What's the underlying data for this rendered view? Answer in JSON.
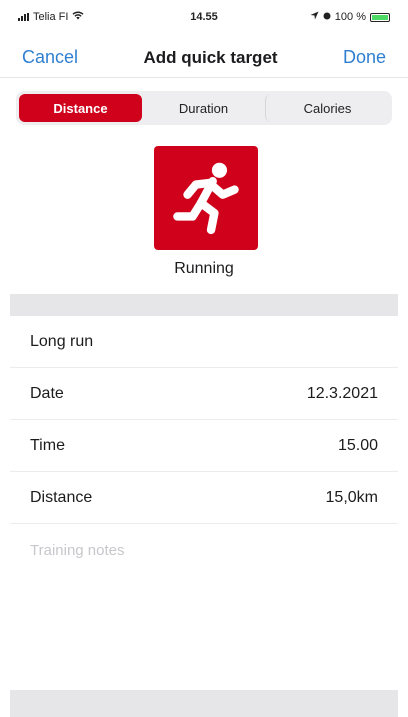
{
  "status_bar": {
    "carrier": "Telia FI",
    "time": "14.55",
    "battery": "100 %"
  },
  "nav": {
    "cancel": "Cancel",
    "title": "Add quick target",
    "done": "Done"
  },
  "segments": [
    {
      "label": "Distance",
      "active": true
    },
    {
      "label": "Duration",
      "active": false
    },
    {
      "label": "Calories",
      "active": false
    }
  ],
  "activity": {
    "icon": "running-person-icon",
    "label": "Running",
    "color": "#d0021b"
  },
  "form": {
    "name": "Long run",
    "date_label": "Date",
    "date_value": "12.3.2021",
    "time_label": "Time",
    "time_value": "15.00",
    "distance_label": "Distance",
    "distance_value": "15,0km",
    "notes_placeholder": "Training notes"
  },
  "colors": {
    "accent_blue": "#2f7fd1",
    "brand_red": "#d0021b"
  }
}
